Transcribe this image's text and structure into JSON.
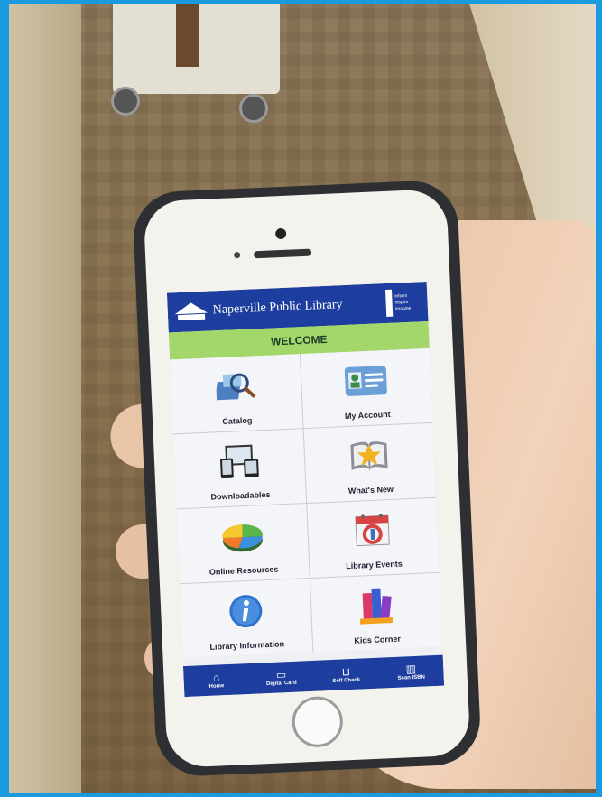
{
  "app": {
    "library_name": "Naperville Public Library",
    "tagline": [
      "inform",
      "inspire",
      "imagine"
    ],
    "welcome": "WELCOME"
  },
  "tiles": [
    {
      "label": "Catalog",
      "icon": "catalog-magnifier-icon"
    },
    {
      "label": "My Account",
      "icon": "id-card-icon"
    },
    {
      "label": "Downloadables",
      "icon": "devices-icon"
    },
    {
      "label": "What's New",
      "icon": "star-book-icon"
    },
    {
      "label": "Online Resources",
      "icon": "pie-chart-icon"
    },
    {
      "label": "Library Events",
      "icon": "calendar-icon"
    },
    {
      "label": "Library Information",
      "icon": "info-icon"
    },
    {
      "label": "Kids Corner",
      "icon": "books-icon"
    }
  ],
  "tabbar": [
    {
      "label": "Home",
      "icon": "home-icon"
    },
    {
      "label": "Digital Card",
      "icon": "card-icon"
    },
    {
      "label": "Self Check",
      "icon": "cart-icon"
    },
    {
      "label": "Scan ISBN",
      "icon": "barcode-icon"
    }
  ],
  "colors": {
    "header": "#1d3e9e",
    "welcome_bar": "#a3d76a",
    "border": "#1a9be0"
  }
}
